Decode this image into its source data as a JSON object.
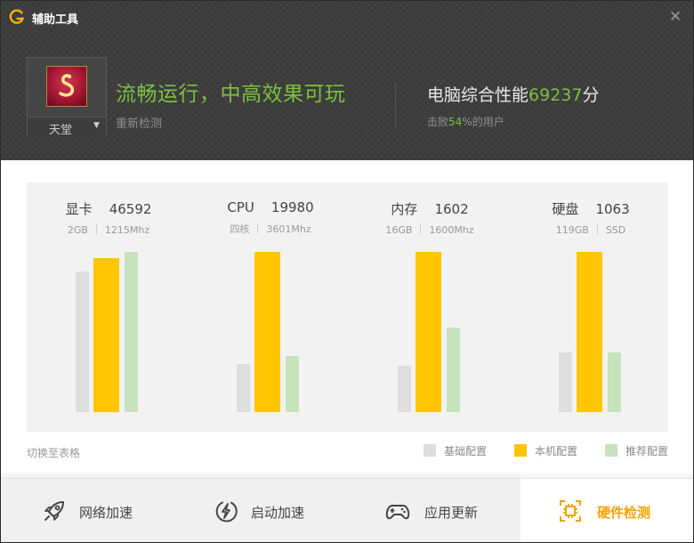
{
  "app": {
    "title": "辅助工具"
  },
  "header": {
    "game_name": "天堂",
    "status_title": "流畅运行，中高效果可玩",
    "recheck_label": "重新检测",
    "score_prefix": "电脑综合性能",
    "score": "69237",
    "score_unit": "分",
    "beat_prefix": "击败",
    "beat_percent": "54",
    "beat_suffix": "%的用户"
  },
  "colors": {
    "accent_green": "#7bc13f",
    "accent_orange": "#f5a200",
    "base": "#dddddd",
    "mine": "#ffc600",
    "recommended": "#c8e2bb"
  },
  "chart_data": {
    "type": "bar",
    "groups": [
      {
        "name": "显卡",
        "score": "46592",
        "spec1": "2GB",
        "spec2": "1215Mhz"
      },
      {
        "name": "CPU",
        "score": "19980",
        "spec1": "四核",
        "spec2": "3601Mhz"
      },
      {
        "name": "内存",
        "score": "1602",
        "spec1": "16GB",
        "spec2": "1600Mhz"
      },
      {
        "name": "硬盘",
        "score": "1063",
        "spec1": "119GB",
        "spec2": "SSD"
      }
    ],
    "series": [
      {
        "name": "基础配置",
        "color": "#dddddd",
        "values": [
          0.88,
          0.3,
          0.29,
          0.37
        ]
      },
      {
        "name": "本机配置",
        "color": "#ffc600",
        "values": [
          0.96,
          1.0,
          1.0,
          1.0
        ]
      },
      {
        "name": "推荐配置",
        "color": "#c8e2bb",
        "values": [
          1.0,
          0.35,
          0.53,
          0.37
        ]
      }
    ],
    "toggle_label": "切换至表格"
  },
  "footer": {
    "tabs": [
      {
        "label": "网络加速",
        "icon": "rocket-icon",
        "active": false
      },
      {
        "label": "启动加速",
        "icon": "lightning-icon",
        "active": false
      },
      {
        "label": "应用更新",
        "icon": "gamepad-icon",
        "active": false
      },
      {
        "label": "硬件检测",
        "icon": "chip-icon",
        "active": true
      }
    ]
  }
}
